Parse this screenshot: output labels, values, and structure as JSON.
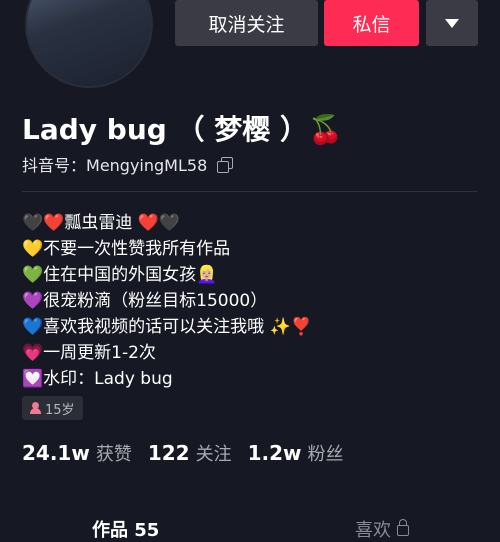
{
  "header": {
    "unfollow_label": "取消关注",
    "message_label": "私信"
  },
  "profile": {
    "name": "Lady bug （ 梦樱 ）🍒",
    "id_label": "抖音号：",
    "id_value": "MengyingML58",
    "bio_lines": [
      "🖤❤️瓢虫雷迪 ❤️🖤",
      "💛不要一次性赞我所有作品",
      "💚住在中国的外国女孩👱🏼‍♀️",
      "💜很宠粉滴（粉丝目标15000）",
      "💙喜欢我视频的话可以关注我哦 ✨❣️",
      "💗一周更新1-2次",
      "💟水印：Lady bug"
    ],
    "age_badge": "15岁"
  },
  "stats": [
    {
      "num": "24.1w",
      "label": "获赞"
    },
    {
      "num": "122",
      "label": "关注"
    },
    {
      "num": "1.2w",
      "label": "粉丝"
    }
  ],
  "tabs": {
    "works": "作品 55",
    "likes": "喜欢"
  }
}
